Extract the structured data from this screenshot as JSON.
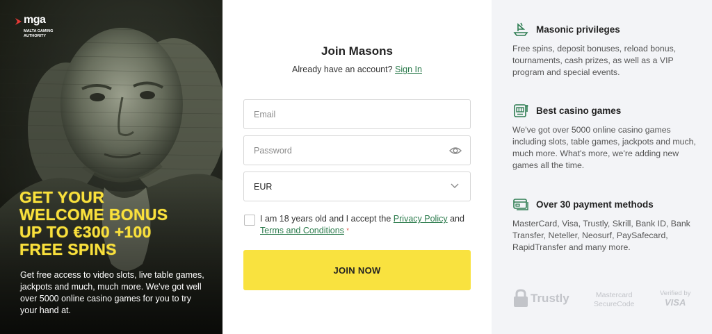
{
  "promo": {
    "mga_word": "mga",
    "mga_sub": "MALTA GAMING AUTHORITY",
    "headline": [
      "GET YOUR",
      "WELCOME BONUS",
      "UP TO €300 +100",
      "FREE SPINS"
    ],
    "text": "Get free access to video slots, live table games, jackpots and much, much more. We've got well over 5000 online casino games for you to try your hand at."
  },
  "form": {
    "title": "Join Masons",
    "account_prompt": "Already have an account?",
    "signin_label": "Sign In",
    "email_placeholder": "Email",
    "password_placeholder": "Password",
    "currency": "EUR",
    "terms_prefix": "I am 18 years old and I accept the",
    "privacy_label": "Privacy Policy",
    "terms_and": "and",
    "terms_label": "Terms and Conditions",
    "required_mark": "*",
    "join_label": "JOIN NOW"
  },
  "info": {
    "features": [
      {
        "icon": "ship-icon",
        "title": "Masonic privileges",
        "text": "Free spins, deposit bonuses, reload bonus, tournaments, cash prizes, as well as a VIP program and special events."
      },
      {
        "icon": "slot-machine-icon",
        "title": "Best casino games",
        "text": "We've got over 5000 online casino games including slots, table games, jackpots and much, much more. What's more, we're adding new games all the time."
      },
      {
        "icon": "credit-card-icon",
        "title": "Over 30 payment methods",
        "text": "MasterCard, Visa, Trustly, Skrill, Bank ID, Bank Transfer, Neteller, Neosurf, PaySafecard, RapidTransfer and many more."
      }
    ],
    "logos": {
      "trustly": "Trustly",
      "mastercard_line1": "Mastercard",
      "mastercard_line2": "SecureCode",
      "visa_line1": "Verified by",
      "visa_line2": "VISA"
    }
  },
  "colors": {
    "accent_yellow": "#f9e23f",
    "headline_yellow": "#f9e03c",
    "link_green": "#2a7a4b",
    "icon_green": "#2e7d52",
    "panel_bg": "#f3f4f7"
  }
}
